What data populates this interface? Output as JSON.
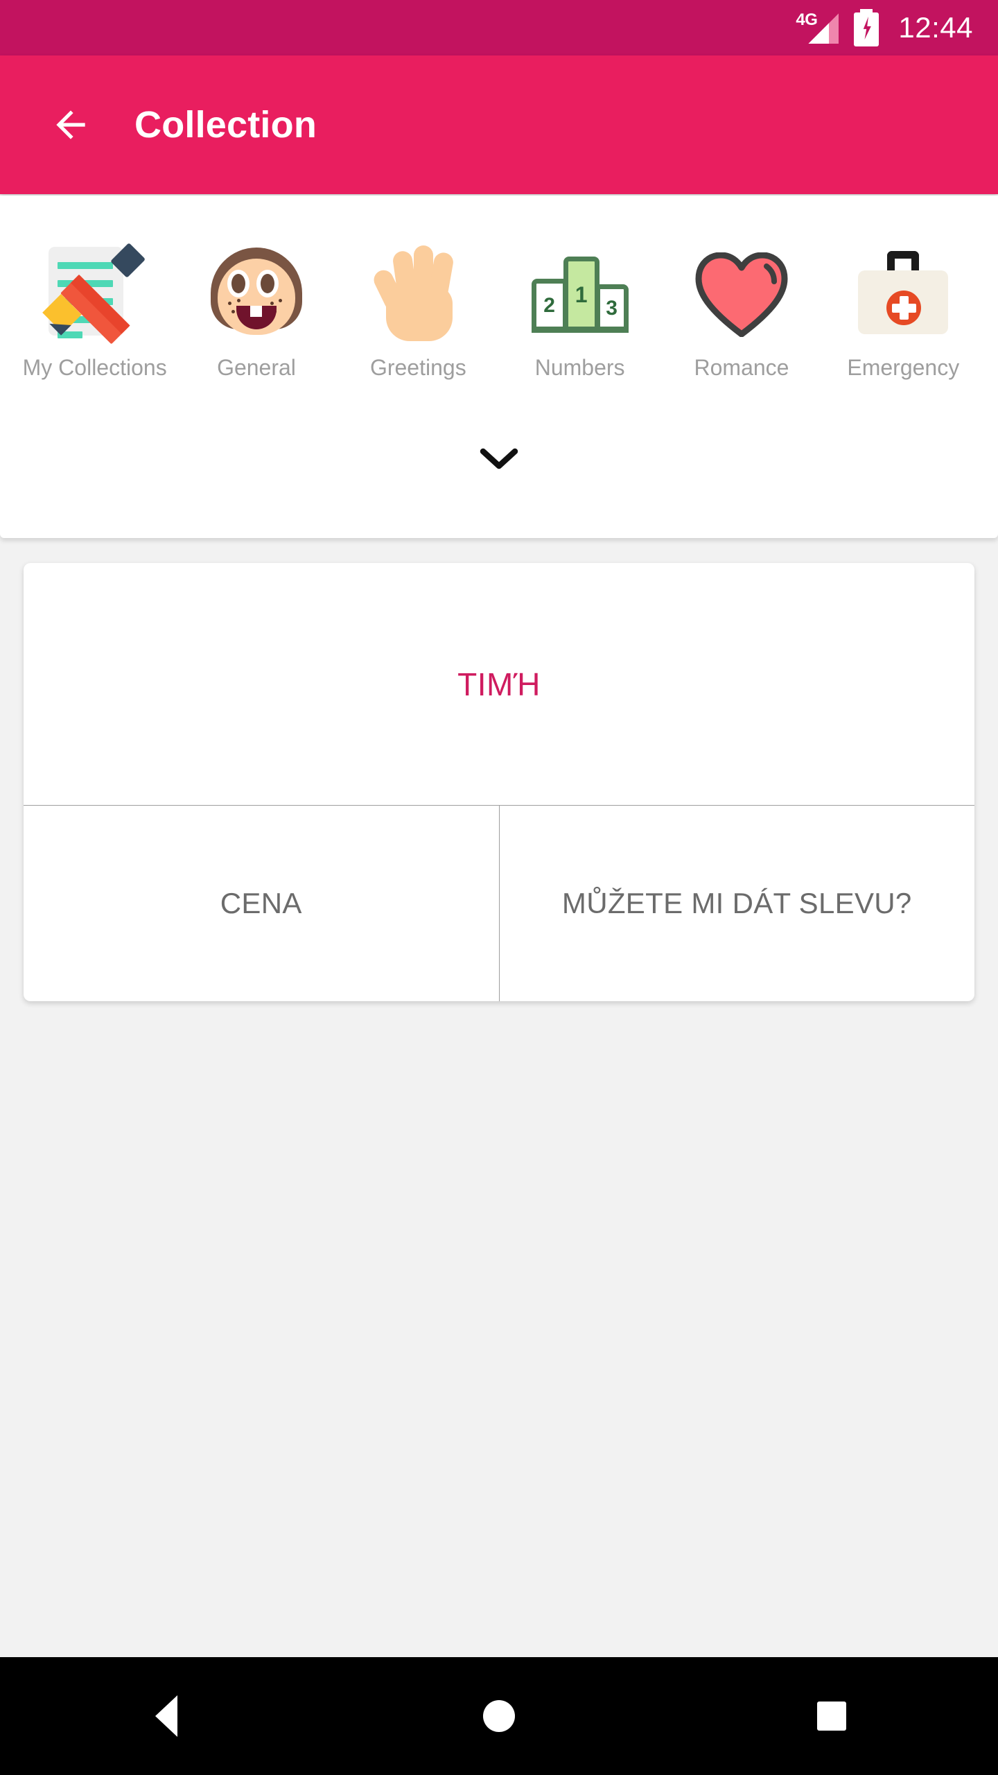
{
  "statusbar": {
    "network_label": "4G",
    "signal_icon": "signal-bars-icon",
    "battery_icon": "battery-charging-icon",
    "time": "12:44",
    "background_color": "#c2135f"
  },
  "appbar": {
    "back_icon": "arrow-left-icon",
    "title": "Collection",
    "background_color": "#e91e5f",
    "text_color": "#ffffff"
  },
  "categories": {
    "items": [
      {
        "label": "My Collections",
        "icon": "memo-pencil-icon"
      },
      {
        "label": "General",
        "icon": "girl-face-icon"
      },
      {
        "label": "Greetings",
        "icon": "raised-hand-icon"
      },
      {
        "label": "Numbers",
        "icon": "podium-icon"
      },
      {
        "label": "Romance",
        "icon": "heart-icon"
      },
      {
        "label": "Emergency",
        "icon": "first-aid-kit-icon"
      }
    ],
    "podium_numbers": {
      "second": "2",
      "first": "1",
      "third": "3"
    },
    "expand_icon": "chevron-down-icon",
    "label_color": "#9e9e9e"
  },
  "card": {
    "headline": "ΤΙΜΉ",
    "headline_color": "#cf1c5f",
    "cells": [
      {
        "text": "CENA"
      },
      {
        "text": "MŮŽETE MI DÁT SLEVU?"
      }
    ],
    "cell_text_color": "#6b6b6b"
  },
  "navbar": {
    "back_icon": "nav-back-triangle-icon",
    "home_icon": "nav-home-circle-icon",
    "recents_icon": "nav-recents-square-icon",
    "background_color": "#000000"
  }
}
